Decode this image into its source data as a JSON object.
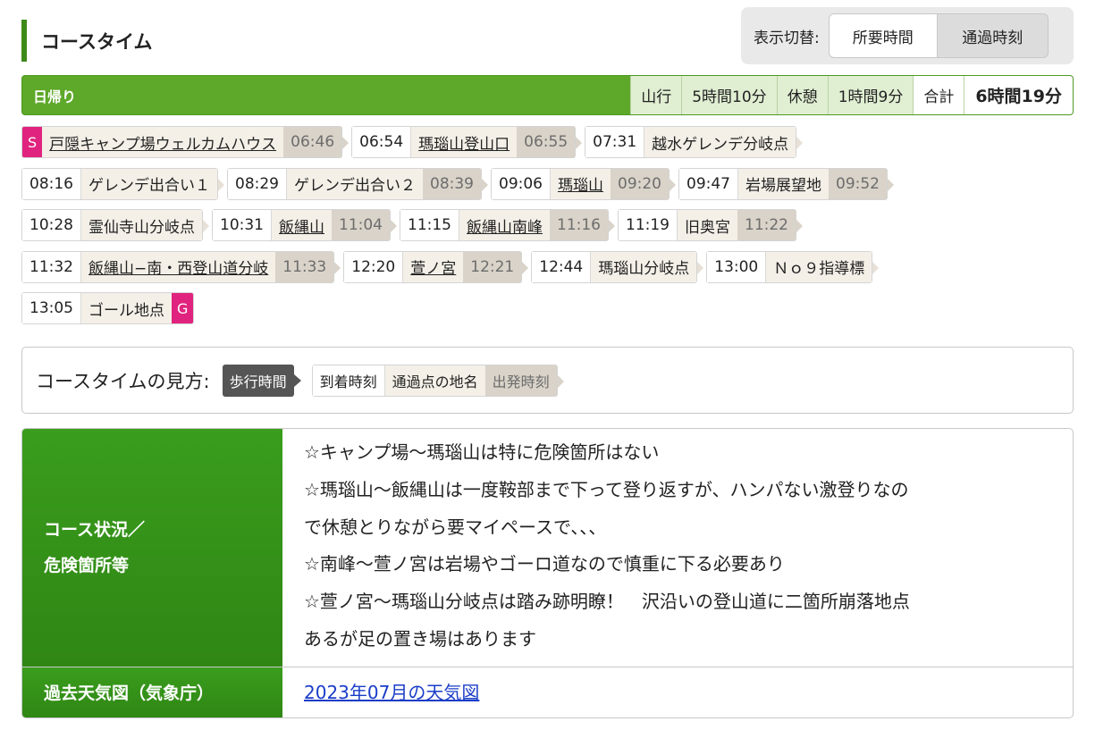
{
  "header": {
    "title": "コースタイム",
    "toggle_label": "表示切替:",
    "toggle_options": [
      "所要時間",
      "通過時刻"
    ]
  },
  "summary": {
    "trip_type": "日帰り",
    "hike_label": "山行",
    "hike_time": "5時間10分",
    "rest_label": "休憩",
    "rest_time": "1時間9分",
    "total_label": "合計",
    "total_time": "6時間19分"
  },
  "course": {
    "start_marker": "S",
    "goal_marker": "G",
    "points": [
      {
        "arrive": "",
        "name": "戸隠キャンプ場ウェルカムハウス",
        "depart": "06:46",
        "link": true
      },
      {
        "arrive": "06:54",
        "name": "瑪瑙山登山口",
        "depart": "06:55",
        "link": true
      },
      {
        "arrive": "07:31",
        "name": "越水ゲレンデ分岐点",
        "depart": "",
        "link": false
      },
      {
        "arrive": "08:16",
        "name": "ゲレンデ出合い１",
        "depart": "",
        "link": false
      },
      {
        "arrive": "08:29",
        "name": "ゲレンデ出合い２",
        "depart": "08:39",
        "link": false
      },
      {
        "arrive": "09:06",
        "name": "瑪瑙山",
        "depart": "09:20",
        "link": true
      },
      {
        "arrive": "09:47",
        "name": "岩場展望地",
        "depart": "09:52",
        "link": false
      },
      {
        "arrive": "10:28",
        "name": "霊仙寺山分岐点",
        "depart": "",
        "link": false
      },
      {
        "arrive": "10:31",
        "name": "飯縄山",
        "depart": "11:04",
        "link": true
      },
      {
        "arrive": "11:15",
        "name": "飯縄山南峰",
        "depart": "11:16",
        "link": true
      },
      {
        "arrive": "11:19",
        "name": "旧奥宮",
        "depart": "11:22",
        "link": false
      },
      {
        "arrive": "11:32",
        "name": "飯縄山−南・西登山道分岐",
        "depart": "11:33",
        "link": true
      },
      {
        "arrive": "12:20",
        "name": "萱ノ宮",
        "depart": "12:21",
        "link": true
      },
      {
        "arrive": "12:44",
        "name": "瑪瑙山分岐点",
        "depart": "",
        "link": false
      },
      {
        "arrive": "13:00",
        "name": "Ｎｏ９指導標",
        "depart": "",
        "link": false
      },
      {
        "arrive": "13:05",
        "name": "ゴール地点",
        "depart": "",
        "link": false
      }
    ]
  },
  "legend": {
    "title": "コースタイムの見方:",
    "walk_time": "歩行時間",
    "arrive": "到着時刻",
    "place": "通過点の地名",
    "depart": "出発時刻"
  },
  "info": {
    "condition_label_1": "コース状況／",
    "condition_label_2": "危険箇所等",
    "condition_lines": [
      "☆キャンプ場〜瑪瑙山は特に危険箇所はない",
      "☆瑪瑙山〜飯縄山は一度鞍部まで下って登り返すが、ハンパない激登りなの",
      "で休憩とりながら要マイペースで、、、",
      "☆南峰〜萱ノ宮は岩場やゴーロ道なので慎重に下る必要あり",
      "☆萱ノ宮〜瑪瑙山分岐点は踏み跡明瞭！　沢沿いの登山道に二箇所崩落地点",
      "あるが足の置き場はあります"
    ],
    "weather_label": "過去天気図（気象庁）",
    "weather_link": "2023年07月の天気図"
  }
}
